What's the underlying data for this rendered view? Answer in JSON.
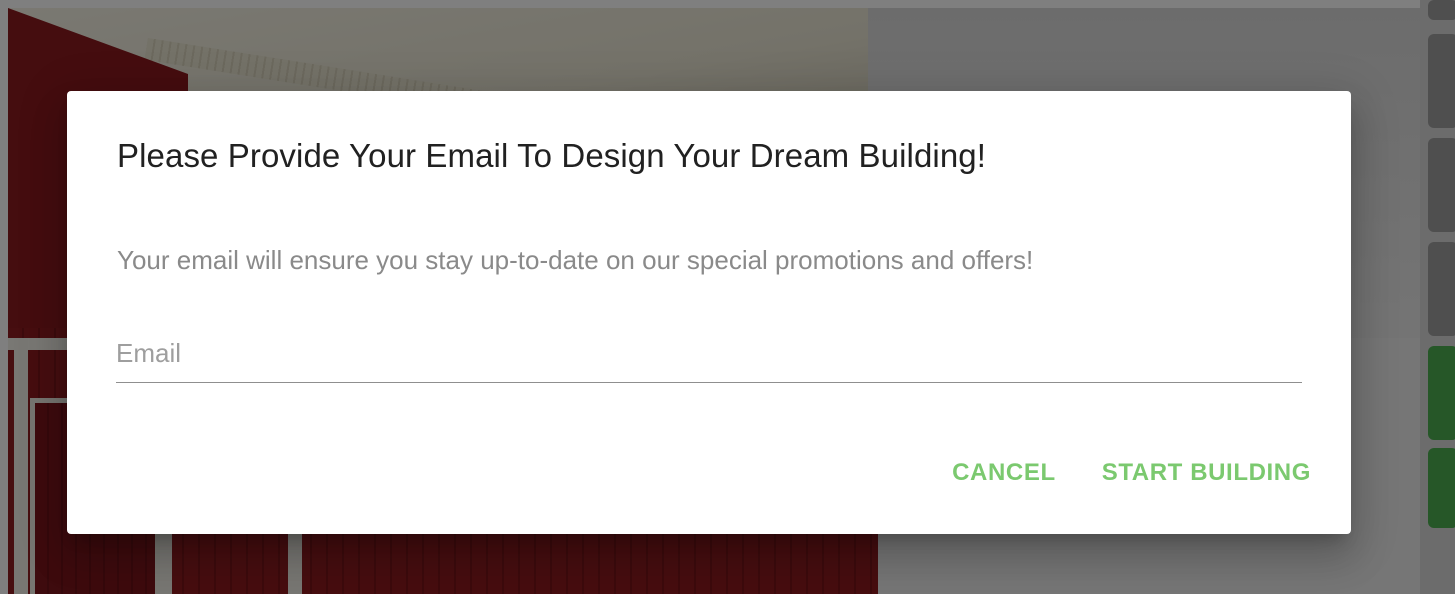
{
  "dialog": {
    "title": "Please Provide Your Email To Design Your Dream Building!",
    "text": "Your email will ensure you stay up-to-date on our special promotions and offers!",
    "email_field": {
      "placeholder": "Email",
      "value": ""
    },
    "actions": {
      "cancel_label": "CANCEL",
      "start_label": "START BUILDING"
    }
  },
  "colors": {
    "accent": "#7bc96f",
    "overlay": "rgba(0,0,0,0.5)",
    "title": "#212121",
    "body_text": "#8a8a8a",
    "side_button_green": "#4caf50"
  }
}
